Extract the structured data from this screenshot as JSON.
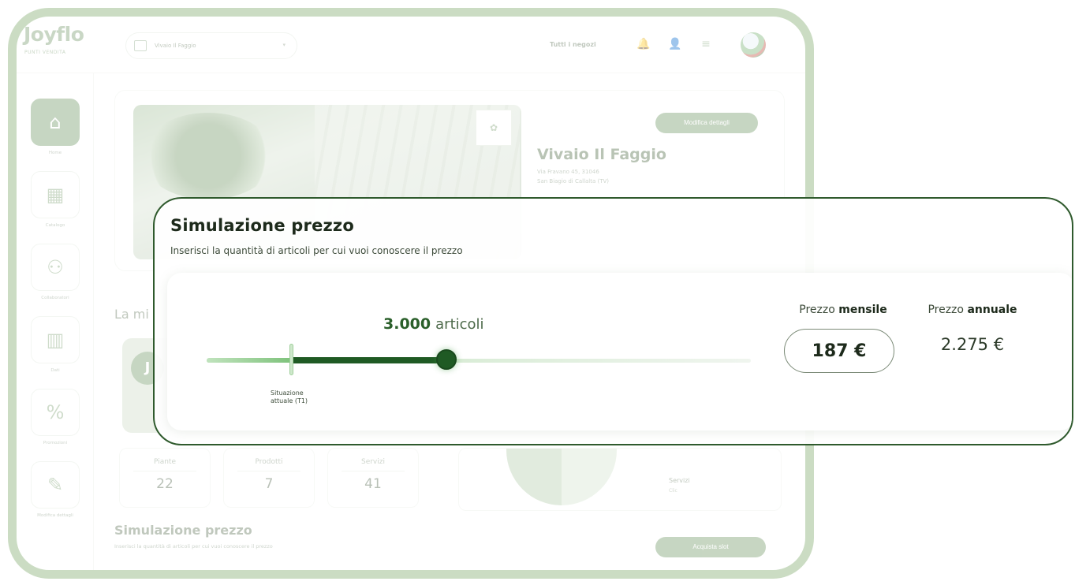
{
  "app": {
    "logo": "Joyflo",
    "logo_sub": "PUNTI VENDITA",
    "store_selector": "Vivaio Il Faggio",
    "store_filter": "Tutti i negozi"
  },
  "sidebar": {
    "items": [
      {
        "label": "Home",
        "icon": "home-icon"
      },
      {
        "label": "Catalogo",
        "icon": "grid-icon"
      },
      {
        "label": "Collaboratori",
        "icon": "users-icon"
      },
      {
        "label": "Dati",
        "icon": "chart-icon"
      },
      {
        "label": "Promozioni",
        "icon": "percent-icon"
      },
      {
        "label": "Modifica dettagli",
        "icon": "pencil-icon"
      }
    ]
  },
  "store": {
    "name": "Vivaio Il Faggio",
    "address_line1": "Via Fravano 45, 31046",
    "address_line2": "San Biagio di Callalta (TV)",
    "edit_label": "Modifica dettagli"
  },
  "main": {
    "section_title": "La mi",
    "avatar_initial": "J",
    "stats": [
      {
        "label": "Piante",
        "value": "22"
      },
      {
        "label": "Prodotti",
        "value": "7"
      },
      {
        "label": "Servizi",
        "value": "41"
      }
    ],
    "legend_label": "Servizi",
    "legend_sub": "Clic",
    "bg_sim_title": "Simulazione prezzo",
    "bg_sim_sub": "Inserisci la quantità di articoli per cui vuoi conoscere il prezzo",
    "buy_label": "Acquista slot"
  },
  "simulation": {
    "title": "Simulazione prezzo",
    "subtitle": "Inserisci la quantità di articoli per cui vuoi conoscere il prezzo",
    "count_value": "3.000",
    "count_unit": "articoli",
    "slider_fraction": 0.44,
    "marker_fraction": 0.157,
    "marker_label_line1": "Situazione",
    "marker_label_line2": "attuale (T1)",
    "monthly_label_prefix": "Prezzo",
    "monthly_label_strong": "mensile",
    "monthly_price": "187 €",
    "annual_label_prefix": "Prezzo",
    "annual_label_strong": "annuale",
    "annual_price": "2.275 €"
  },
  "colors": {
    "frame": "#cbdcc3",
    "overlay_border": "#2f5a2d",
    "slider_fill": "#1f5a24",
    "accent": "#7a9e6f"
  }
}
